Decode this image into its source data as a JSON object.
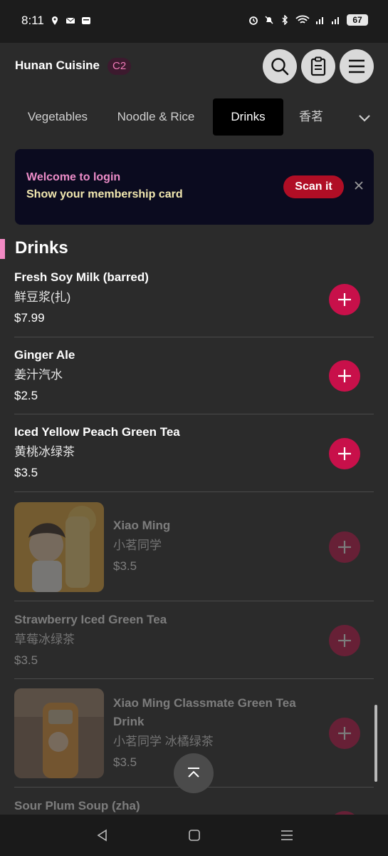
{
  "status_bar": {
    "time": "8:11",
    "battery": "67"
  },
  "header": {
    "store_name": "Hunan Cuisine",
    "table_code": "C2"
  },
  "tabs": [
    {
      "label": "Vegetables",
      "active": false
    },
    {
      "label": "Noodle & Rice",
      "active": false
    },
    {
      "label": "Drinks",
      "active": true
    },
    {
      "label": "香茗",
      "active": false
    }
  ],
  "banner": {
    "line1": "Welcome to login",
    "line2": "Show your membership card",
    "scan_label": "Scan it"
  },
  "section": {
    "title": "Drinks"
  },
  "items": [
    {
      "name_en": "Fresh Soy Milk (barred)",
      "name_zh": "鲜豆浆(扎)",
      "price": "$7.99",
      "available": true
    },
    {
      "name_en": "Ginger Ale",
      "name_zh": "姜汁汽水",
      "price": "$2.5",
      "available": true
    },
    {
      "name_en": "Iced Yellow Peach Green Tea",
      "name_zh": "黄桃冰绿茶",
      "price": "$3.5",
      "available": true
    },
    {
      "name_en": "Xiao Ming",
      "name_zh": "小茗同学",
      "price": "$3.5",
      "available": false
    },
    {
      "name_en": "Strawberry Iced Green Tea",
      "name_zh": "草莓冰绿茶",
      "price": "$3.5",
      "available": false
    },
    {
      "name_en": "Xiao Ming Classmate Green Tea Drink",
      "name_zh": "小茗同学 冰橘绿茶",
      "price": "$3.5",
      "available": false
    },
    {
      "name_en": "Sour Plum Soup (zha)",
      "name_zh": "",
      "price": "",
      "available": false
    }
  ],
  "colors": {
    "accent_pink": "#f28ac4",
    "add_button": "#c8104a",
    "scan_button": "#b00e25",
    "banner_bg": "#0b0b1f"
  }
}
